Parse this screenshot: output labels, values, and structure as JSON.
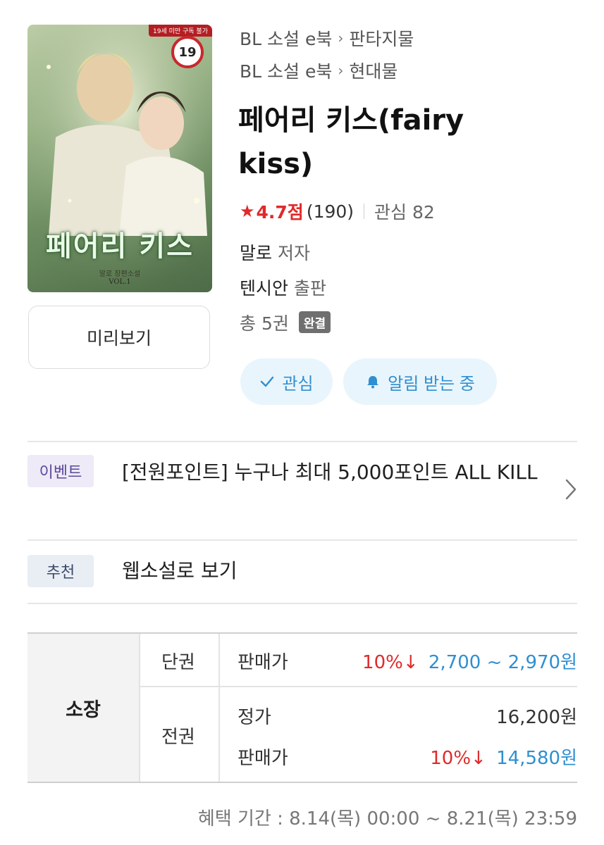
{
  "cover": {
    "age_notice": "19세 미만 구독 불가",
    "age_rating": "19",
    "title_art": "페어리 키스",
    "subtitle_art": "말로 장편소설",
    "volume_art": "VOL.1"
  },
  "preview_button": "미리보기",
  "breadcrumbs": [
    {
      "root": "BL 소설 e북",
      "leaf": "판타지물"
    },
    {
      "root": "BL 소설 e북",
      "leaf": "현대물"
    }
  ],
  "title": "페어리 키스(fairy kiss)",
  "rating": {
    "score": "4.7점",
    "count": "(190)",
    "interest": "관심 82"
  },
  "author": {
    "name": "말로",
    "role": "저자"
  },
  "publisher": {
    "name": "텐시안",
    "role": "출판"
  },
  "volumes": {
    "text": "총 5권",
    "status": "완결"
  },
  "actions": {
    "interest": "관심",
    "notify": "알림 받는 중"
  },
  "event": {
    "tag": "이벤트",
    "text": "[전원포인트] 누구나 최대 5,000포인트 ALL KILL"
  },
  "recommend": {
    "tag": "추천",
    "text": "웹소설로 보기"
  },
  "price": {
    "section": "소장",
    "single": {
      "label": "단권",
      "price_label": "판매가",
      "discount": "10%↓",
      "range": "2,700 ~ 2,970원"
    },
    "set": {
      "label": "전권",
      "list_label": "정가",
      "list_price": "16,200원",
      "sale_label": "판매가",
      "discount": "10%↓",
      "sale_price": "14,580원"
    }
  },
  "benefit_period": "혜택 기간 : 8.14(목) 00:00 ~ 8.21(목) 23:59",
  "colors": {
    "accent_blue": "#2f8fd1",
    "accent_red": "#e02a2a",
    "pill_bg": "#e9f5fc"
  }
}
